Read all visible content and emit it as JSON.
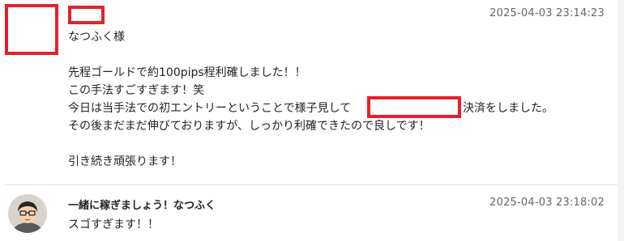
{
  "comment1": {
    "timestamp": "2025-04-03 23:14:23",
    "greeting": "なつふく様",
    "line1": "先程ゴールドで約100pips程利確しました！！",
    "line2": "この手法すごすぎます！笑",
    "line3_a": "今日は当手法での初エントリーということで様子見して",
    "line3_b": "決済をしました。",
    "line4": "その後まだまだ伸びておりますが、しっかり利確できたので良しです！",
    "line5": "引き続き頑張ります！"
  },
  "comment2": {
    "author": "一緒に稼ぎましょう！なつふく",
    "timestamp": "2025-04-03 23:18:02",
    "line1": "スゴすぎます！！"
  },
  "colors": {
    "redaction": "#e5202a",
    "timestamp": "#666666",
    "divider": "#e3e3e3"
  }
}
